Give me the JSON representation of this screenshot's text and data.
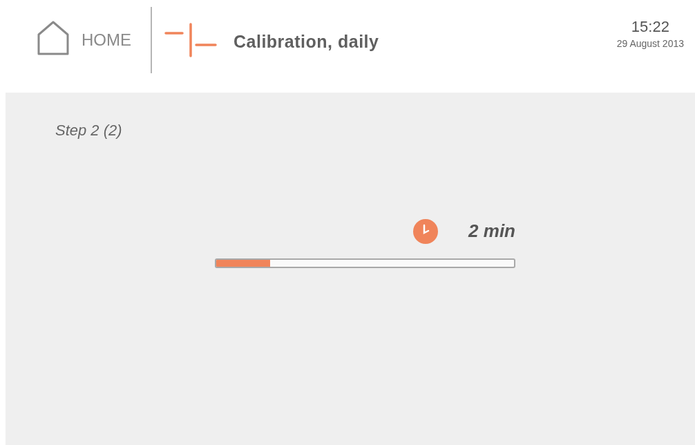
{
  "header": {
    "home_label": "HOME",
    "title": "Calibration, daily",
    "time": "15:22",
    "date": "29 August 2013"
  },
  "content": {
    "step": "Step 2 (2)",
    "remaining": "2 min",
    "progress": {
      "level": 0.18
    }
  }
}
